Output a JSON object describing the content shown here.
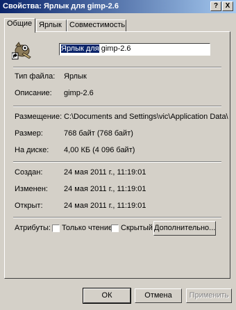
{
  "window": {
    "title": "Свойства: Ярлык для gimp-2.6"
  },
  "titlebar": {
    "help": "?",
    "close": "X"
  },
  "tabs": [
    {
      "label": "Общие"
    },
    {
      "label": "Ярлык"
    },
    {
      "label": "Совместимость"
    }
  ],
  "general": {
    "name_selected": "Ярлык для",
    "name_rest": " gimp-2.6",
    "rows": {
      "type": {
        "label": "Тип файла:",
        "value": "Ярлык"
      },
      "desc": {
        "label": "Описание:",
        "value": "gimp-2.6"
      },
      "location": {
        "label": "Размещение:",
        "value": "C:\\Documents and Settings\\vic\\Application Data\\"
      },
      "size": {
        "label": "Размер:",
        "value": "768 байт (768 байт)"
      },
      "disk": {
        "label": "На диске:",
        "value": "4,00 КБ (4 096 байт)"
      },
      "created": {
        "label": "Создан:",
        "value": "24 мая 2011 г., 11:19:01"
      },
      "modified": {
        "label": "Изменен:",
        "value": "24 мая 2011 г., 11:19:01"
      },
      "accessed": {
        "label": "Открыт:",
        "value": "24 мая 2011 г., 11:19:01"
      }
    },
    "attributes": {
      "label": "Атрибуты:",
      "readonly": "Только чтение",
      "hidden": "Скрытый",
      "advanced": "Дополнительно..."
    }
  },
  "buttons": {
    "ok": "ОК",
    "cancel": "Отмена",
    "apply": "Применить"
  }
}
